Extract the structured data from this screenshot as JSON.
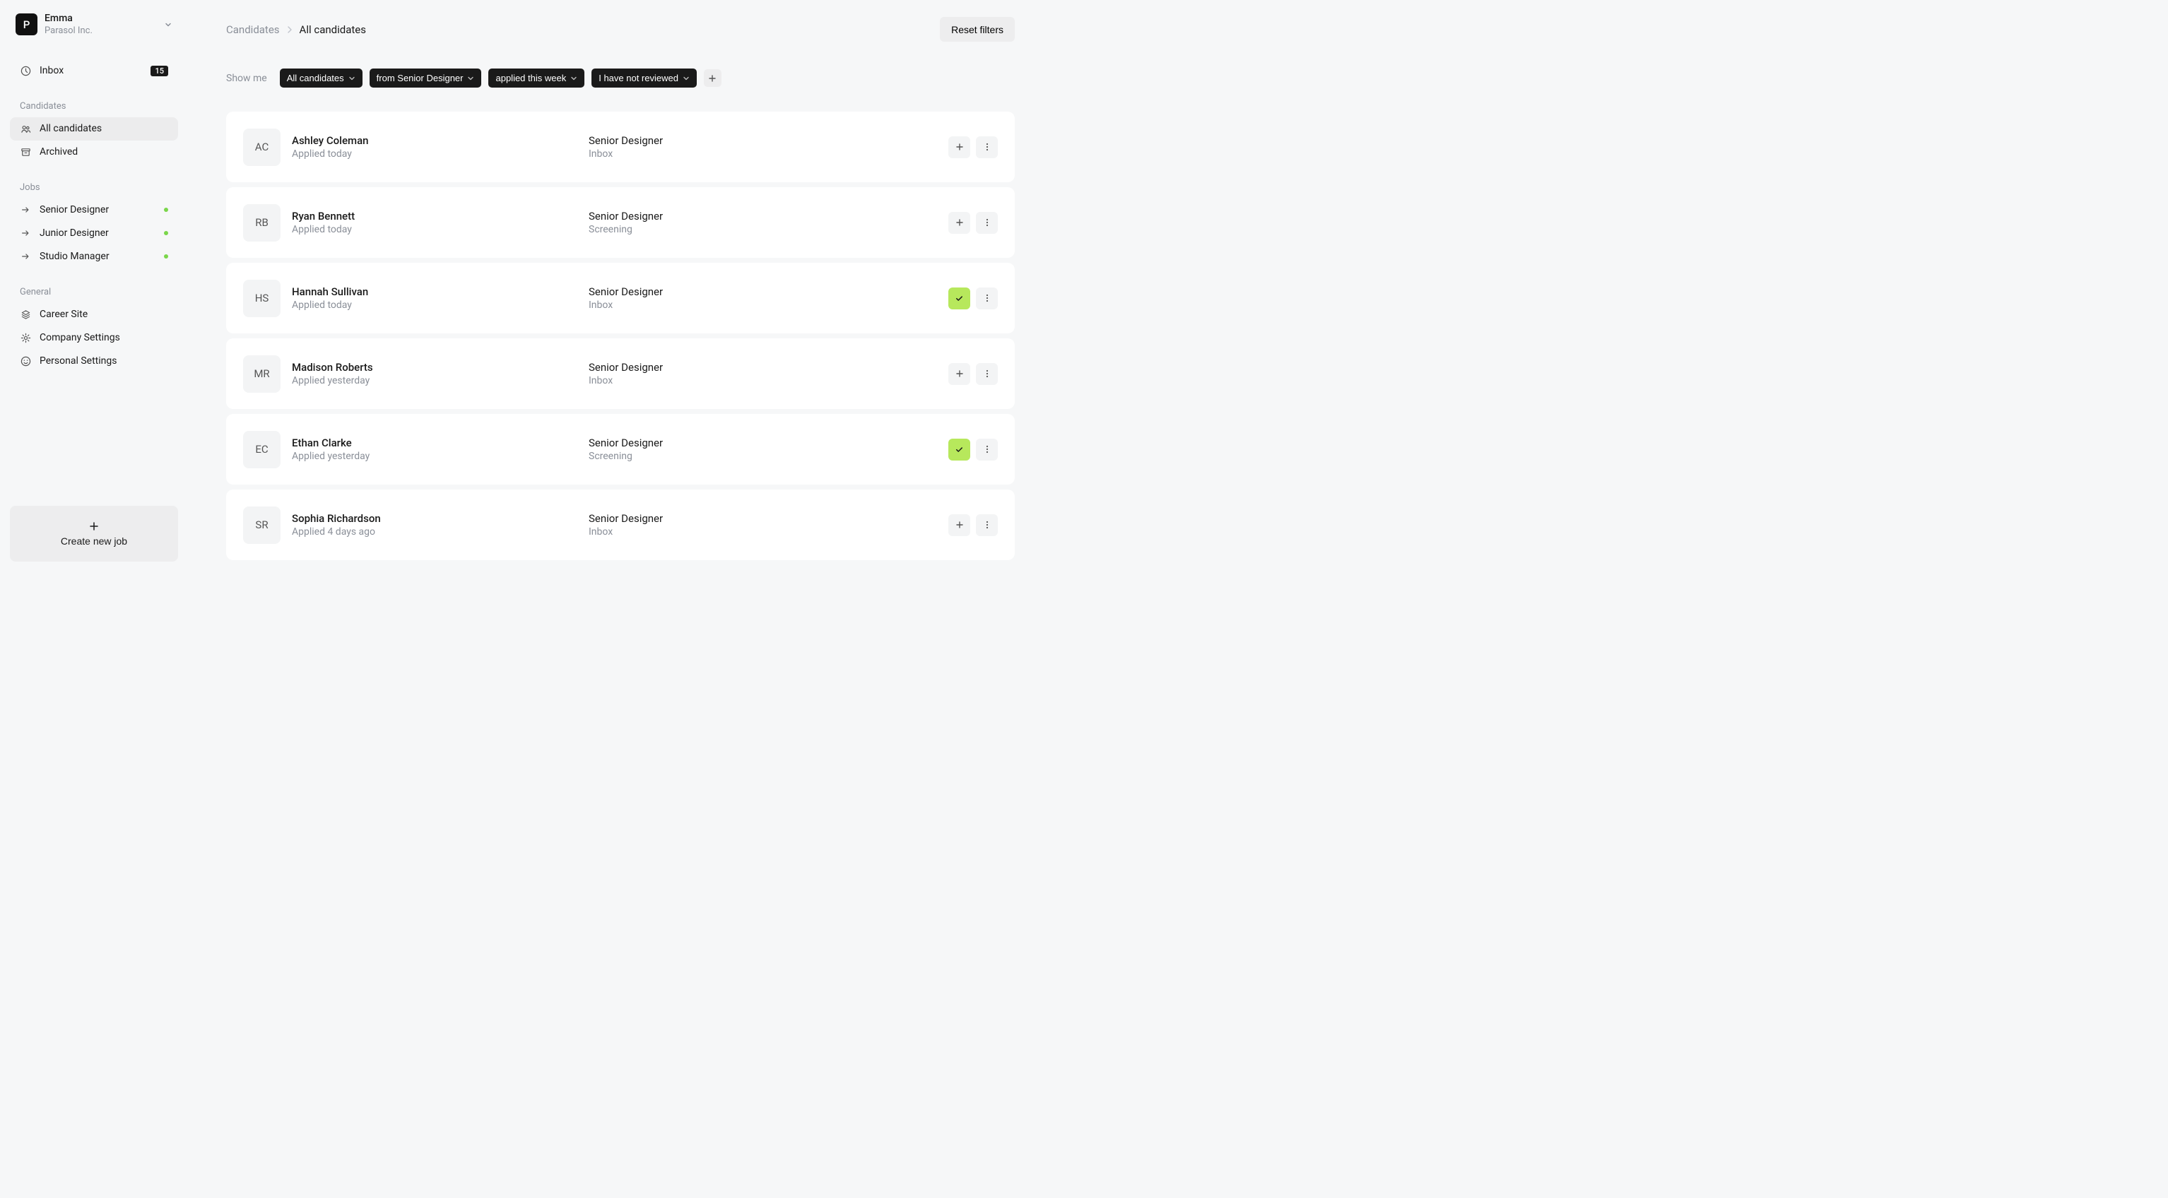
{
  "org": {
    "initial": "P",
    "name": "Emma",
    "company": "Parasol Inc."
  },
  "sidebar": {
    "inbox": {
      "label": "Inbox",
      "count": "15"
    },
    "sections": {
      "candidates": {
        "title": "Candidates",
        "items": [
          {
            "label": "All candidates",
            "active": true
          },
          {
            "label": "Archived"
          }
        ]
      },
      "jobs": {
        "title": "Jobs",
        "items": [
          {
            "label": "Senior Designer"
          },
          {
            "label": "Junior Designer"
          },
          {
            "label": "Studio Manager"
          }
        ]
      },
      "general": {
        "title": "General",
        "items": [
          {
            "label": "Career Site"
          },
          {
            "label": "Company Settings"
          },
          {
            "label": "Personal Settings"
          }
        ]
      }
    },
    "create_job": "Create new job"
  },
  "breadcrumb": {
    "root": "Candidates",
    "current": "All candidates"
  },
  "reset_filters": "Reset filters",
  "filters": {
    "label": "Show me",
    "chips": [
      "All candidates",
      "from Senior Designer",
      "applied this week",
      "I have not reviewed"
    ]
  },
  "candidates": [
    {
      "initials": "AC",
      "name": "Ashley Coleman",
      "applied": "Applied today",
      "role": "Senior Designer",
      "stage": "Inbox",
      "checked": false
    },
    {
      "initials": "RB",
      "name": "Ryan Bennett",
      "applied": "Applied today",
      "role": "Senior Designer",
      "stage": "Screening",
      "checked": false
    },
    {
      "initials": "HS",
      "name": "Hannah Sullivan",
      "applied": "Applied today",
      "role": "Senior Designer",
      "stage": "Inbox",
      "checked": true
    },
    {
      "initials": "MR",
      "name": "Madison Roberts",
      "applied": "Applied yesterday",
      "role": "Senior Designer",
      "stage": "Inbox",
      "checked": false
    },
    {
      "initials": "EC",
      "name": "Ethan Clarke",
      "applied": "Applied yesterday",
      "role": "Senior Designer",
      "stage": "Screening",
      "checked": true
    },
    {
      "initials": "SR",
      "name": "Sophia Richardson",
      "applied": "Applied 4 days ago",
      "role": "Senior Designer",
      "stage": "Inbox",
      "checked": false
    }
  ]
}
